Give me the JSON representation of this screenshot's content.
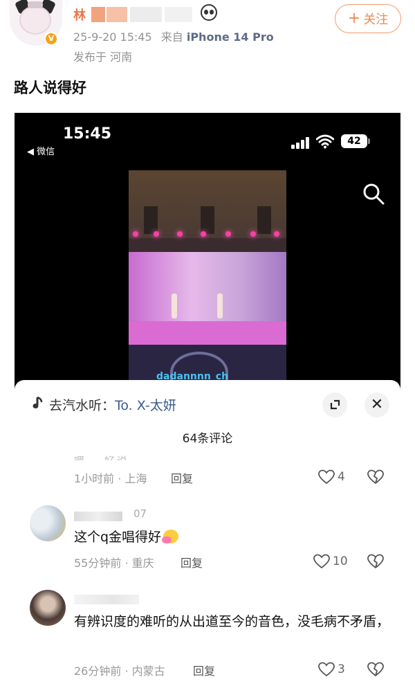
{
  "post": {
    "username_initial": "林",
    "timestamp": "25-9-20 15:45",
    "from_label": "来自",
    "device": "iPhone 14 Pro",
    "location": "发布于 河南",
    "follow_label": "关注",
    "follow_plus": "+",
    "text": "路人说得好",
    "verified_mark": "V"
  },
  "embedded_screen": {
    "status_time": "15:45",
    "back_label": "◀ 微信",
    "battery": "42",
    "subtitle_fragment": "dadannnn_ch"
  },
  "comment_sheet": {
    "music_prefix": "去汽水听：",
    "music_track": "To. X-太妍",
    "close_glyph": "✕",
    "comment_count": "64条评论",
    "comments": [
      {
        "truncated_text": "嗯… 好说…",
        "time_location": "1小时前 · 上海",
        "reply_label": "回复",
        "likes": "4"
      },
      {
        "name_suffix": "07",
        "text": "这个q金唱得好",
        "time_location": "55分钟前 · 重庆",
        "reply_label": "回复",
        "likes": "10"
      },
      {
        "text": "有辨识度的难听的从出道至今的音色，没毛病不矛盾，",
        "time_location": "26分钟前 · 内蒙古",
        "reply_label": "回复",
        "likes": "3"
      }
    ]
  },
  "colors": {
    "accent_orange": "#f08a52",
    "link_blue": "#3b5b8a",
    "muted_gray": "#999999"
  },
  "icons": [
    "panda-icon",
    "verified-badge-icon",
    "signal-icon",
    "wifi-icon",
    "battery-icon",
    "search-icon",
    "music-note-icon",
    "expand-icon",
    "close-icon",
    "heart-icon",
    "broken-heart-icon"
  ]
}
